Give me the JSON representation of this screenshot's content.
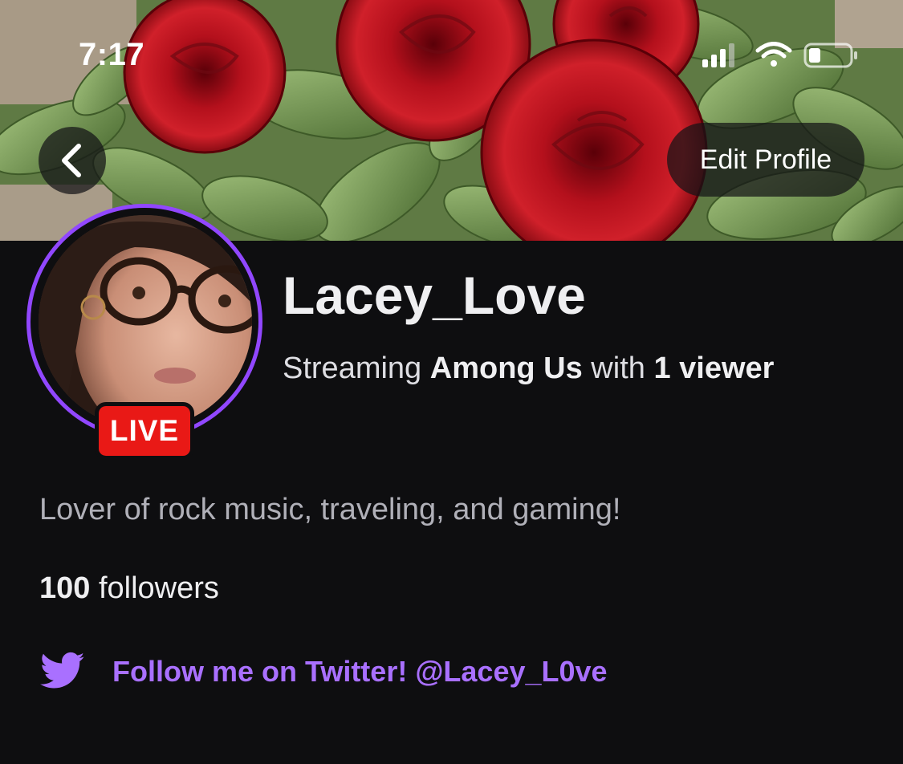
{
  "status_bar": {
    "time": "7:17",
    "icons": [
      "cellular-signal-icon",
      "wifi-icon",
      "battery-icon"
    ]
  },
  "header": {
    "back_icon": "chevron-left-icon",
    "edit_profile_label": "Edit Profile",
    "banner_description": "red-roses-banner"
  },
  "profile": {
    "live_label": "LIVE",
    "username": "Lacey_Love",
    "streaming_prefix": "Streaming ",
    "game": "Among Us",
    "streaming_middle": " with ",
    "viewers": "1 viewer",
    "bio": "Lover of rock music, traveling, and gaming!",
    "followers_count": "100",
    "followers_label": " followers",
    "twitter_link": "Follow me on Twitter! @Lacey_L0ve"
  },
  "colors": {
    "background": "#0e0e10",
    "accent_purple": "#9147ff",
    "link_purple": "#a970ff",
    "live_red": "#e91916"
  }
}
